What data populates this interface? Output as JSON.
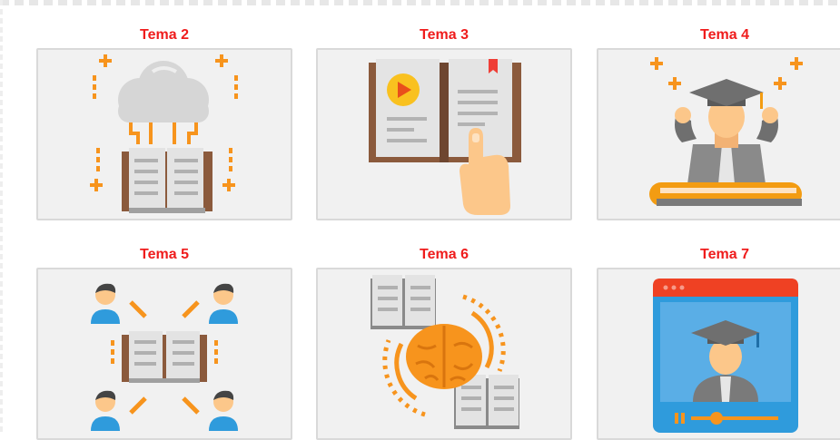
{
  "cards": [
    {
      "title": "Tema 2",
      "icon": "cloud-book-icon"
    },
    {
      "title": "Tema 3",
      "icon": "interactive-book-icon"
    },
    {
      "title": "Tema 4",
      "icon": "graduate-success-icon"
    },
    {
      "title": "Tema 5",
      "icon": "shared-knowledge-icon"
    },
    {
      "title": "Tema 6",
      "icon": "brain-learning-icon"
    },
    {
      "title": "Tema 7",
      "icon": "online-graduate-icon"
    }
  ],
  "colors": {
    "title": "#ef1c1c",
    "card_background": "#f1f1f1",
    "card_border": "#d9d9d9",
    "accent_orange": "#f39c12"
  }
}
